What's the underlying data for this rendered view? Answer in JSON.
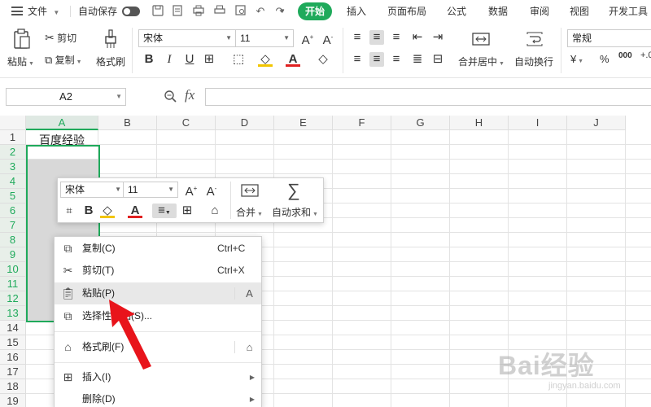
{
  "menubar": {
    "file": "文件",
    "autosave": "自动保存",
    "tabs": [
      "开始",
      "插入",
      "页面布局",
      "公式",
      "数据",
      "审阅",
      "视图",
      "开发工具"
    ]
  },
  "ribbon": {
    "paste": "粘贴",
    "cut": "剪切",
    "copy": "复制",
    "format_painter": "格式刷",
    "font_name": "宋体",
    "font_size": "11",
    "merge_center": "合并居中",
    "wrap_text": "自动换行",
    "number_format": "常规",
    "bold": "B",
    "italic": "I",
    "underline": "U",
    "currency": "¥",
    "percent": "%",
    "thousands": "000"
  },
  "formula_bar": {
    "name_box": "A2",
    "fx": "fx",
    "value": ""
  },
  "grid": {
    "columns": [
      "A",
      "B",
      "C",
      "D",
      "E",
      "F",
      "G",
      "H",
      "I",
      "J"
    ],
    "rows": [
      "1",
      "2",
      "3",
      "4",
      "5",
      "6",
      "7",
      "8",
      "9",
      "10",
      "11",
      "12",
      "13",
      "14",
      "15",
      "16",
      "17",
      "18",
      "19"
    ],
    "a1_text": "百度经验"
  },
  "mini_toolbar": {
    "font_name": "宋体",
    "font_size": "11",
    "bold": "B",
    "merge": "合并",
    "autosum": "自动求和"
  },
  "context_menu": {
    "items": [
      {
        "label": "复制(C)",
        "shortcut": "Ctrl+C"
      },
      {
        "label": "剪切(T)",
        "shortcut": "Ctrl+X"
      },
      {
        "label": "粘贴(P)",
        "shortcut": ""
      },
      {
        "label": "选择性粘贴(S)...",
        "shortcut": ""
      },
      {
        "label": "格式刷(F)",
        "shortcut": ""
      },
      {
        "label": "插入(I)",
        "shortcut": ""
      },
      {
        "label": "删除(D)",
        "shortcut": ""
      }
    ]
  },
  "watermark": {
    "brand": "Bai经验",
    "url": "jingyan.baidu.com"
  },
  "colors": {
    "accent": "#1faa5b",
    "arrow": "#e8141b",
    "selection_fill": "#d8d8d8"
  }
}
